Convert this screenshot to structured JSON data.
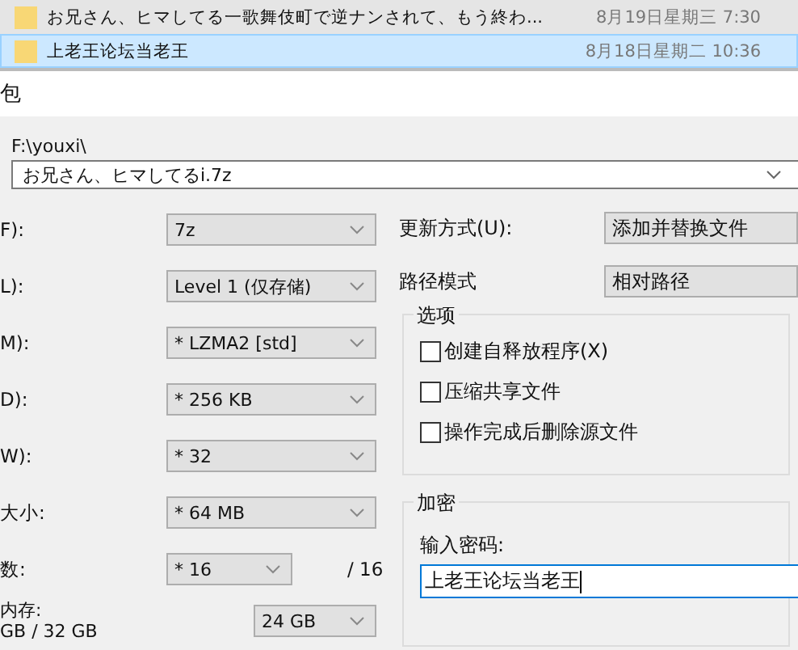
{
  "file_list": [
    {
      "name": "お兄さん、ヒマしてる一歌舞伎町で逆ナンされて、もう終わ...",
      "date": "8月19日星期三 7:30",
      "selected": false
    },
    {
      "name": "上老王论坛当老王",
      "date": "8月18日星期二 10:36",
      "selected": true
    }
  ],
  "dialog": {
    "title": "包"
  },
  "archive": {
    "folder": "F:\\youxi\\",
    "name": "お兄さん、ヒマしてるi.7z"
  },
  "settings": [
    {
      "kind": "select",
      "label": "F):",
      "value": "7z"
    },
    {
      "kind": "select",
      "label": "L):",
      "value": "Level 1 (仅存储)"
    },
    {
      "kind": "select",
      "label": "M):",
      "value": "* LZMA2 [std]"
    },
    {
      "kind": "select",
      "label": "D):",
      "value": "* 256 KB"
    },
    {
      "kind": "select",
      "label": "W):",
      "value": "* 32"
    },
    {
      "kind": "select",
      "label": "大小:",
      "value": "* 64 MB"
    },
    {
      "kind": "threads",
      "label": "数:",
      "value": "* 16",
      "suffix": "/ 16"
    },
    {
      "kind": "memory",
      "label": "内存:",
      "sublabel": "GB / 32 GB",
      "value": "24 GB"
    }
  ],
  "update_mode": {
    "label": "更新方式(U):",
    "value": "添加并替换文件"
  },
  "path_mode": {
    "label": "路径模式",
    "value": "相对路径"
  },
  "options": {
    "title": "选项",
    "items": [
      {
        "label": "创建自释放程序(X)",
        "checked": false
      },
      {
        "label": "压缩共享文件",
        "checked": false
      },
      {
        "label": "操作完成后删除源文件",
        "checked": false
      }
    ]
  },
  "encryption": {
    "title": "加密",
    "label": "输入密码:",
    "value": "上老王论坛当老王"
  }
}
